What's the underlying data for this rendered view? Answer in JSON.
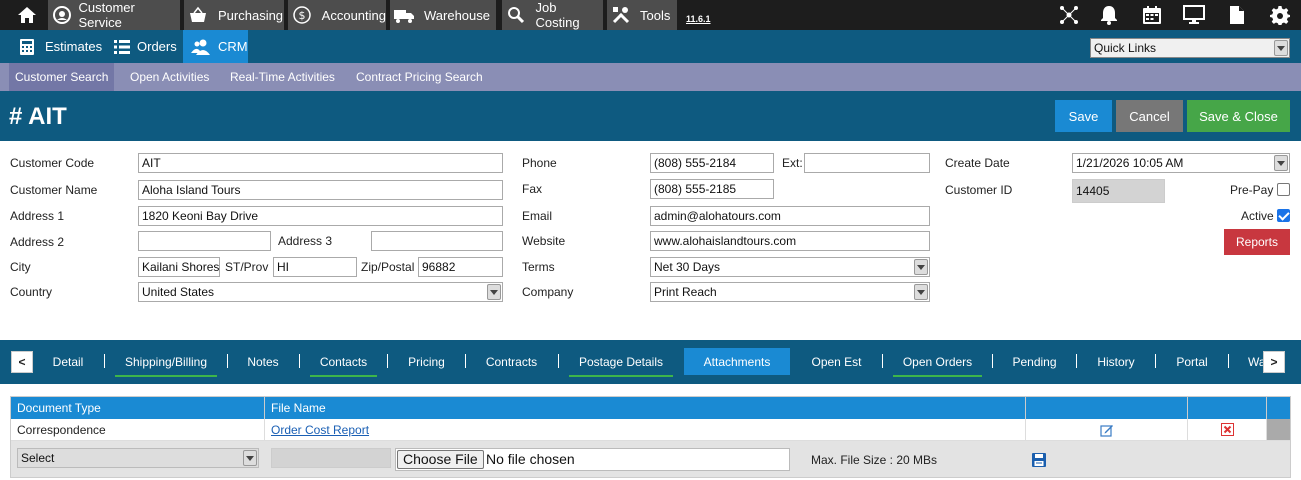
{
  "topnav": {
    "items": [
      {
        "label": "Customer Service",
        "icon": "headset-icon"
      },
      {
        "label": "Purchasing",
        "icon": "basket-icon"
      },
      {
        "label": "Accounting",
        "icon": "dollar-icon"
      },
      {
        "label": "Warehouse",
        "icon": "truck-icon"
      },
      {
        "label": "Job Costing",
        "icon": "search-icon"
      },
      {
        "label": "Tools",
        "icon": "tools-icon"
      }
    ],
    "version": "11.6.1"
  },
  "subnav": {
    "items": [
      {
        "label": "Estimates",
        "icon": "calculator-icon"
      },
      {
        "label": "Orders",
        "icon": "list-icon"
      },
      {
        "label": "CRM",
        "icon": "users-icon"
      }
    ],
    "quick_links": "Quick Links"
  },
  "crm_tabs": [
    "Customer Search",
    "Open Activities",
    "Real-Time Activities",
    "Contract Pricing Search"
  ],
  "header": {
    "title": "# AIT",
    "save": "Save",
    "cancel": "Cancel",
    "save_close": "Save & Close"
  },
  "form": {
    "customer_code": {
      "label": "Customer Code",
      "value": "AIT"
    },
    "customer_name": {
      "label": "Customer Name",
      "value": "Aloha Island Tours"
    },
    "address1": {
      "label": "Address 1",
      "value": "1820 Keoni Bay Drive"
    },
    "address2": {
      "label": "Address 2",
      "value": ""
    },
    "address3": {
      "label": "Address 3",
      "value": ""
    },
    "city": {
      "label": "City",
      "value": "Kailani Shores"
    },
    "state": {
      "label": "ST/Prov",
      "value": "HI"
    },
    "zip": {
      "label": "Zip/Postal",
      "value": "96882"
    },
    "country": {
      "label": "Country",
      "value": "United States"
    },
    "phone": {
      "label": "Phone",
      "value": "(808) 555-2184"
    },
    "ext": {
      "label": "Ext:",
      "value": ""
    },
    "fax": {
      "label": "Fax",
      "value": "(808) 555-2185"
    },
    "email": {
      "label": "Email",
      "value": "admin@alohatours.com"
    },
    "website": {
      "label": "Website",
      "value": "www.alohaislandtours.com"
    },
    "terms": {
      "label": "Terms",
      "value": "Net 30 Days"
    },
    "company": {
      "label": "Company",
      "value": "Print Reach"
    },
    "create_date": {
      "label": "Create Date",
      "value": "1/21/2026 10:05 AM"
    },
    "customer_id": {
      "label": "Customer ID",
      "value": "14405"
    },
    "prepay": {
      "label": "Pre-Pay",
      "checked": false
    },
    "active": {
      "label": "Active",
      "checked": true
    },
    "reports": "Reports"
  },
  "detail_tabs": {
    "prev": "<",
    "next": ">",
    "items": [
      "Detail",
      "Shipping/Billing",
      "Notes",
      "Contacts",
      "Pricing",
      "Contracts",
      "Postage Details",
      "Attachments",
      "Open Est",
      "Open Orders",
      "Pending",
      "History",
      "Portal",
      "Wa"
    ]
  },
  "attachments": {
    "columns": [
      "Document Type",
      "File Name"
    ],
    "rows": [
      {
        "document_type": "Correspondence",
        "file_name": "Order Cost Report"
      }
    ],
    "select_label": "Select",
    "choose_file": "Choose File",
    "no_file": "No file chosen",
    "max_size": "Max. File Size : 20 MBs"
  },
  "colors": {
    "top_bar": "#1d1d1d",
    "nav_blue": "#0e5a80",
    "active_blue": "#1a8ad3",
    "purple_bar": "#8a8eb5",
    "cancel_gray": "#777777",
    "save_close_green": "#46a648",
    "reports_red": "#c8373f"
  }
}
